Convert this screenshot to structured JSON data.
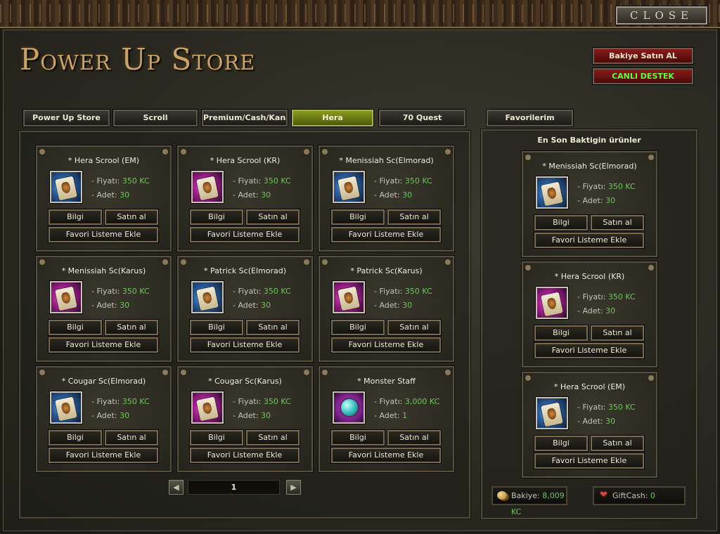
{
  "window": {
    "close_label": "CLOSE"
  },
  "header": {
    "title": "Power Up Store",
    "buy_balance_label": "Bakiye Satın AL",
    "live_support_label": "CANLI DESTEK"
  },
  "tabs": [
    {
      "label": "Power Up Store",
      "active": false
    },
    {
      "label": "Scroll",
      "active": false
    },
    {
      "label": "Premium/Cash/Kana",
      "active": false
    },
    {
      "label": "Hera",
      "active": true
    },
    {
      "label": "70 Quest",
      "active": false
    }
  ],
  "favorites_tab": {
    "label": "Favorilerim"
  },
  "labels": {
    "price": "- Fiyatı:",
    "quantity": "- Adet:",
    "info": "Bilgi",
    "buy": "Satın al",
    "add_favorite": "Favori Listeme Ekle"
  },
  "products": [
    {
      "name": "* Hera Scrool (EM)",
      "price": "350 KC",
      "quantity": "30",
      "icon": "scroll-icon",
      "theme": "blue"
    },
    {
      "name": "* Hera Scrool (KR)",
      "price": "350 KC",
      "quantity": "30",
      "icon": "scroll-icon",
      "theme": "magenta"
    },
    {
      "name": "* Menissiah Sc(Elmorad)",
      "price": "350 KC",
      "quantity": "30",
      "icon": "scroll-icon",
      "theme": "blue"
    },
    {
      "name": "* Menissiah Sc(Karus)",
      "price": "350 KC",
      "quantity": "30",
      "icon": "scroll-icon",
      "theme": "magenta"
    },
    {
      "name": "* Patrick Sc(Elmorad)",
      "price": "350 KC",
      "quantity": "30",
      "icon": "scroll-icon",
      "theme": "blue"
    },
    {
      "name": "* Patrick Sc(Karus)",
      "price": "350 KC",
      "quantity": "30",
      "icon": "scroll-icon",
      "theme": "magenta"
    },
    {
      "name": "* Cougar Sc(Elmorad)",
      "price": "350 KC",
      "quantity": "30",
      "icon": "scroll-icon",
      "theme": "blue"
    },
    {
      "name": "* Cougar Sc(Karus)",
      "price": "350 KC",
      "quantity": "30",
      "icon": "scroll-icon",
      "theme": "magenta"
    },
    {
      "name": "* Monster Staff",
      "price": "3,000 KC",
      "quantity": "1",
      "icon": "gem-icon",
      "theme": "staff"
    }
  ],
  "pagination": {
    "current_page": "1"
  },
  "recent": {
    "title": "En Son Baktigin ürünler",
    "items": [
      {
        "name": "* Menissiah Sc(Elmorad)",
        "price": "350 KC",
        "quantity": "30",
        "icon": "scroll-icon",
        "theme": "blue"
      },
      {
        "name": "* Hera Scrool (KR)",
        "price": "350 KC",
        "quantity": "30",
        "icon": "scroll-icon",
        "theme": "magenta"
      },
      {
        "name": "* Hera Scrool (EM)",
        "price": "350 KC",
        "quantity": "30",
        "icon": "scroll-icon",
        "theme": "blue"
      }
    ]
  },
  "balance": {
    "label": "Bakiye:",
    "value": "8,009 KC"
  },
  "giftcash": {
    "label": "GiftCash:",
    "value": "0"
  }
}
